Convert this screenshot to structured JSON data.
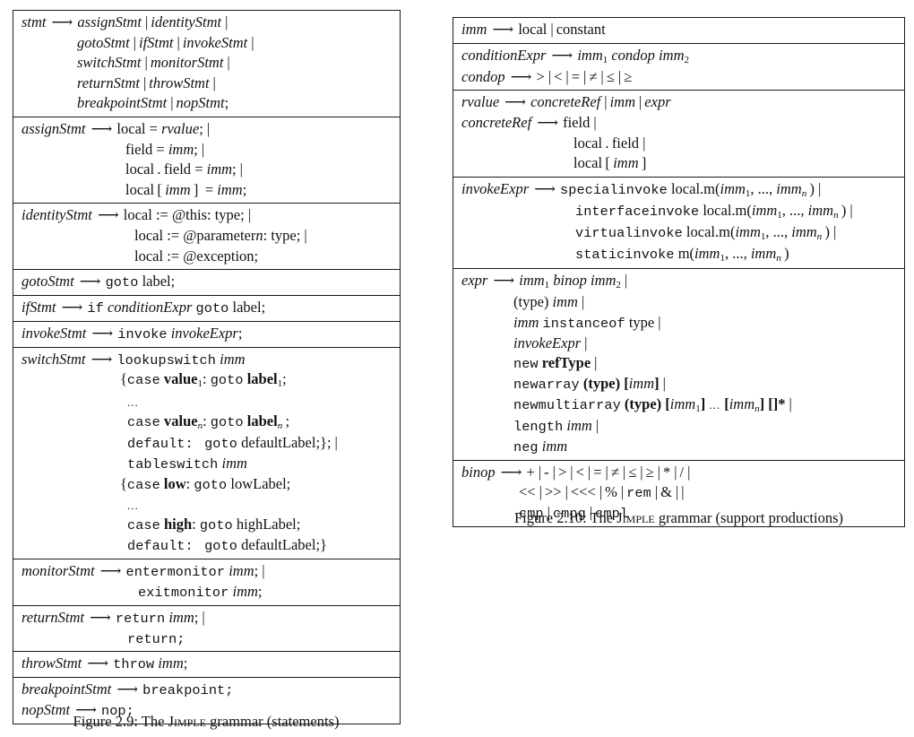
{
  "figures": {
    "statements": {
      "caption_prefix": "Figure 2.9: The ",
      "caption_name": "Jimple",
      "caption_suffix": " grammar (statements)",
      "rows": [
        {
          "name": "stmt",
          "lines": [
            "stmt ⟶ assignStmt | identityStmt |",
            "gotoStmt | ifStmt | invokeStmt |",
            "switchStmt | monitorStmt |",
            "returnStmt | throwStmt |",
            "breakpointStmt | nopStmt;"
          ]
        },
        {
          "name": "assignStmt",
          "lines": [
            "assignStmt ⟶ local = rvalue; |",
            "field = imm; |",
            "local . field = imm; |",
            "local [ imm ] = imm;"
          ]
        },
        {
          "name": "identityStmt",
          "lines": [
            "identityStmt ⟶ local := @this: type; |",
            "local := @parametern: type; |",
            "local := @exception;"
          ]
        },
        {
          "name": "gotoStmt",
          "lines": [
            "gotoStmt ⟶ goto label;"
          ]
        },
        {
          "name": "ifStmt",
          "lines": [
            "ifStmt ⟶ if conditionExpr goto label;"
          ]
        },
        {
          "name": "invokeStmt",
          "lines": [
            "invokeStmt ⟶ invoke invokeExpr;"
          ]
        },
        {
          "name": "switchStmt",
          "lines": [
            "switchStmt ⟶ lookupswitch imm",
            "{case value1: goto label1;",
            "...",
            "case valuen: goto labeln;",
            "default:   goto defaultLabel;}; |",
            "tableswitch imm",
            "{case low: goto lowLabel;",
            "...",
            "case high: goto highLabel;",
            "default:   goto defaultLabel;}"
          ]
        },
        {
          "name": "monitorStmt",
          "lines": [
            "monitorStmt ⟶ entermonitor imm; |",
            "exitmonitor imm;"
          ]
        },
        {
          "name": "returnStmt",
          "lines": [
            "returnStmt ⟶ return imm; |",
            "return;"
          ]
        },
        {
          "name": "throwStmt",
          "lines": [
            "throwStmt ⟶ throw imm;"
          ]
        },
        {
          "name": "breakpointStmt-nopStmt",
          "lines": [
            "breakpointStmt ⟶ breakpoint;",
            "nopStmt ⟶ nop;"
          ]
        }
      ]
    },
    "support": {
      "caption_prefix": "Figure 2.10: The ",
      "caption_name": "Jimple",
      "caption_suffix": " grammar (support productions)",
      "rows": [
        {
          "name": "imm",
          "lines": [
            "imm ⟶ local | constant"
          ]
        },
        {
          "name": "conditionExpr-condop",
          "lines": [
            "conditionExpr ⟶ imm1 condop imm2",
            "condop ⟶ > | < | = | ≠ | ≤ | ≥"
          ]
        },
        {
          "name": "rvalue-concreteRef",
          "lines": [
            "rvalue ⟶ concreteRef | imm | expr",
            "concreteRef ⟶ field |",
            "local . field |",
            "local [ imm ]"
          ]
        },
        {
          "name": "invokeExpr",
          "lines": [
            "invokeExpr ⟶ specialinvoke local.m(imm1, ..., immn) |",
            "interfaceinvoke local.m(imm1, ..., immn) |",
            "virtualinvoke local.m(imm1, ..., immn) |",
            "staticinvoke m(imm1, ..., immn)"
          ]
        },
        {
          "name": "expr",
          "lines": [
            "expr ⟶ imm1 binop imm2 |",
            "(type) imm |",
            "imm instanceof type |",
            "invokeExpr |",
            "new refType |",
            "newarray (type) [imm] |",
            "newmultiarray (type) [imm1] ... [immn] []* |",
            "length imm |",
            "neg imm"
          ]
        },
        {
          "name": "binop",
          "lines": [
            "binop ⟶ + | - | > | < | = | ≠ | ≤ | ≥ | * | / |",
            "<< | >> | <<< | % | rem | & | | |",
            "cmp | cmpg | cmpl"
          ]
        }
      ]
    }
  }
}
